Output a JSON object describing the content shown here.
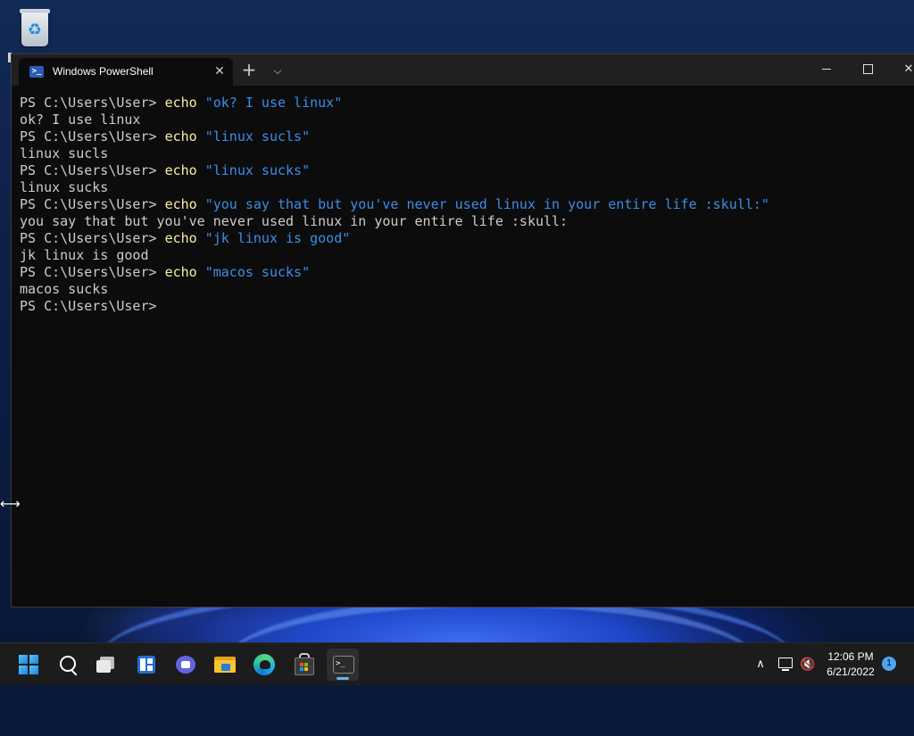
{
  "window": {
    "tab_title": "Windows PowerShell",
    "tab_close": "✕",
    "new_tab": "+",
    "dropdown": "⌵",
    "min": "",
    "max": "",
    "close": "✕"
  },
  "console": {
    "lines": [
      {
        "prompt": "PS C:\\Users\\User> ",
        "cmd": "echo",
        "arg": " \"ok? I use linux\""
      },
      {
        "output": "ok? I use linux"
      },
      {
        "prompt": "PS C:\\Users\\User> ",
        "cmd": "echo",
        "arg": " \"linux sucls\""
      },
      {
        "output": "linux sucls"
      },
      {
        "prompt": "PS C:\\Users\\User> ",
        "cmd": "echo",
        "arg": " \"linux sucks\""
      },
      {
        "output": "linux sucks"
      },
      {
        "prompt": "PS C:\\Users\\User> ",
        "cmd": "echo",
        "arg": " \"you say that but you've never used linux in your entire life :skull:\""
      },
      {
        "output": "you say that but you've never used linux in your entire life :skull:"
      },
      {
        "prompt": "PS C:\\Users\\User> ",
        "cmd": "echo",
        "arg": " \"jk linux is good\""
      },
      {
        "output": "jk linux is good"
      },
      {
        "prompt": "PS C:\\Users\\User> ",
        "cmd": "echo",
        "arg": " \"macos sucks\""
      },
      {
        "output": "macos sucks"
      },
      {
        "prompt": "PS C:\\Users\\User>",
        "cmd": "",
        "arg": ""
      }
    ]
  },
  "taskbar": {
    "items": [
      {
        "name": "start-button",
        "icon": "windows-logo-icon"
      },
      {
        "name": "search-button",
        "icon": "search-icon"
      },
      {
        "name": "task-view-button",
        "icon": "task-view-icon"
      },
      {
        "name": "widgets-button",
        "icon": "widgets-icon"
      },
      {
        "name": "teams-chat-button",
        "icon": "teams-chat-icon"
      },
      {
        "name": "file-explorer-button",
        "icon": "folder-icon"
      },
      {
        "name": "edge-button",
        "icon": "edge-browser-icon"
      },
      {
        "name": "store-button",
        "icon": "store-icon"
      },
      {
        "name": "terminal-button",
        "icon": "terminal-icon"
      }
    ],
    "clock": {
      "time": "12:06 PM",
      "date": "6/21/2022"
    },
    "notification_count": "1",
    "tray_chevron": "∧",
    "volume_glyph": "🔇"
  },
  "colors": {
    "console_bg": "#0c0c0c",
    "console_text": "#cccccc",
    "command": "#f9f1a5",
    "string": "#3b8eea",
    "titlebar": "#202020",
    "taskbar": "#1c1c1c"
  }
}
